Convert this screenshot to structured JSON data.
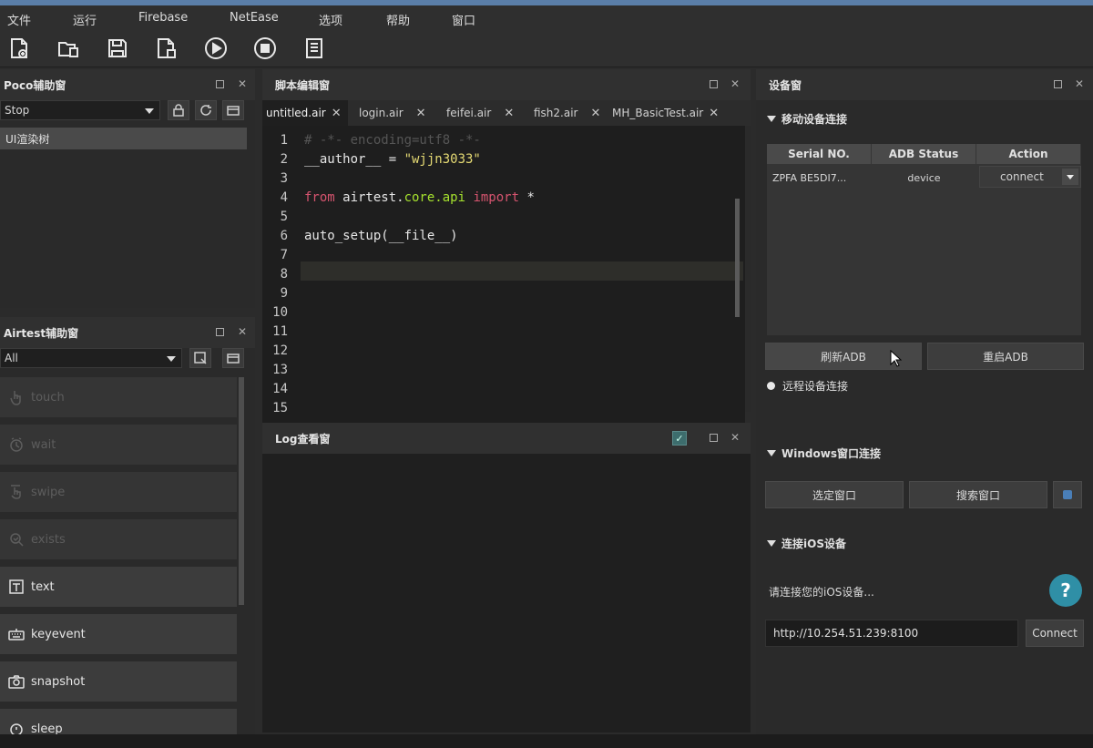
{
  "menubar": [
    "文件",
    "运行",
    "Firebase",
    "NetEase",
    "选项",
    "帮助",
    "窗口"
  ],
  "toolbar_icons": [
    "new-file-icon",
    "open-folder-icon",
    "save-icon",
    "save-as-icon",
    "run-icon",
    "stop-icon",
    "report-icon"
  ],
  "poco": {
    "title": "Poco辅助窗",
    "select_value": "Stop",
    "tree_item": "UI渲染树"
  },
  "airtest": {
    "title": "Airtest辅助窗",
    "select_value": "All",
    "items": [
      {
        "label": "touch",
        "icon": "touch-icon",
        "enabled": false
      },
      {
        "label": "wait",
        "icon": "clock-icon",
        "enabled": false
      },
      {
        "label": "swipe",
        "icon": "swipe-icon",
        "enabled": false
      },
      {
        "label": "exists",
        "icon": "magnifier-icon",
        "enabled": false
      },
      {
        "label": "text",
        "icon": "text-icon",
        "enabled": true
      },
      {
        "label": "keyevent",
        "icon": "keyboard-icon",
        "enabled": true
      },
      {
        "label": "snapshot",
        "icon": "camera-icon",
        "enabled": true
      },
      {
        "label": "sleep",
        "icon": "timer-icon",
        "enabled": true
      }
    ]
  },
  "editor": {
    "title": "脚本编辑窗",
    "tabs": [
      "untitled.air",
      "login.air",
      "feifei.air",
      "fish2.air",
      "MH_BasicTest.air"
    ],
    "line_numbers": [
      "1",
      "2",
      "3",
      "4",
      "5",
      "6",
      "7",
      "8",
      "9",
      "10",
      "11",
      "12",
      "13",
      "14",
      "15"
    ],
    "code": {
      "l1": "# -*- encoding=utf8 -*-",
      "l2_a": "__author__ = ",
      "l2_b": "\"wjjn3033\"",
      "l4_from": "from",
      "l4_mod1": " airtest.",
      "l4_mod2": "core.api",
      "l4_import": " import",
      "l4_star": " *",
      "l6": "auto_setup(__file__)"
    }
  },
  "log": {
    "title": "Log查看窗"
  },
  "device": {
    "title": "设备窗",
    "mobile_section": "移动设备连接",
    "columns": [
      "Serial NO.",
      "ADB Status",
      "Action"
    ],
    "row": {
      "serial": "ZPFA BE5DI7...",
      "status": "device",
      "action": "connect"
    },
    "refresh_adb": "刷新ADB",
    "restart_adb": "重启ADB",
    "remote_section": "远程设备连接",
    "windows_section": "Windows窗口连接",
    "select_window": "选定窗口",
    "search_window": "搜索窗口",
    "ios_section": "连接iOS设备",
    "ios_prompt": "请连接您的iOS设备...",
    "ios_url": "http://10.254.51.239:8100",
    "connect": "Connect"
  },
  "colors": {
    "keyword": "#d6546f",
    "string": "#e6db74",
    "module": "#a6e22e",
    "comment": "#555555"
  }
}
